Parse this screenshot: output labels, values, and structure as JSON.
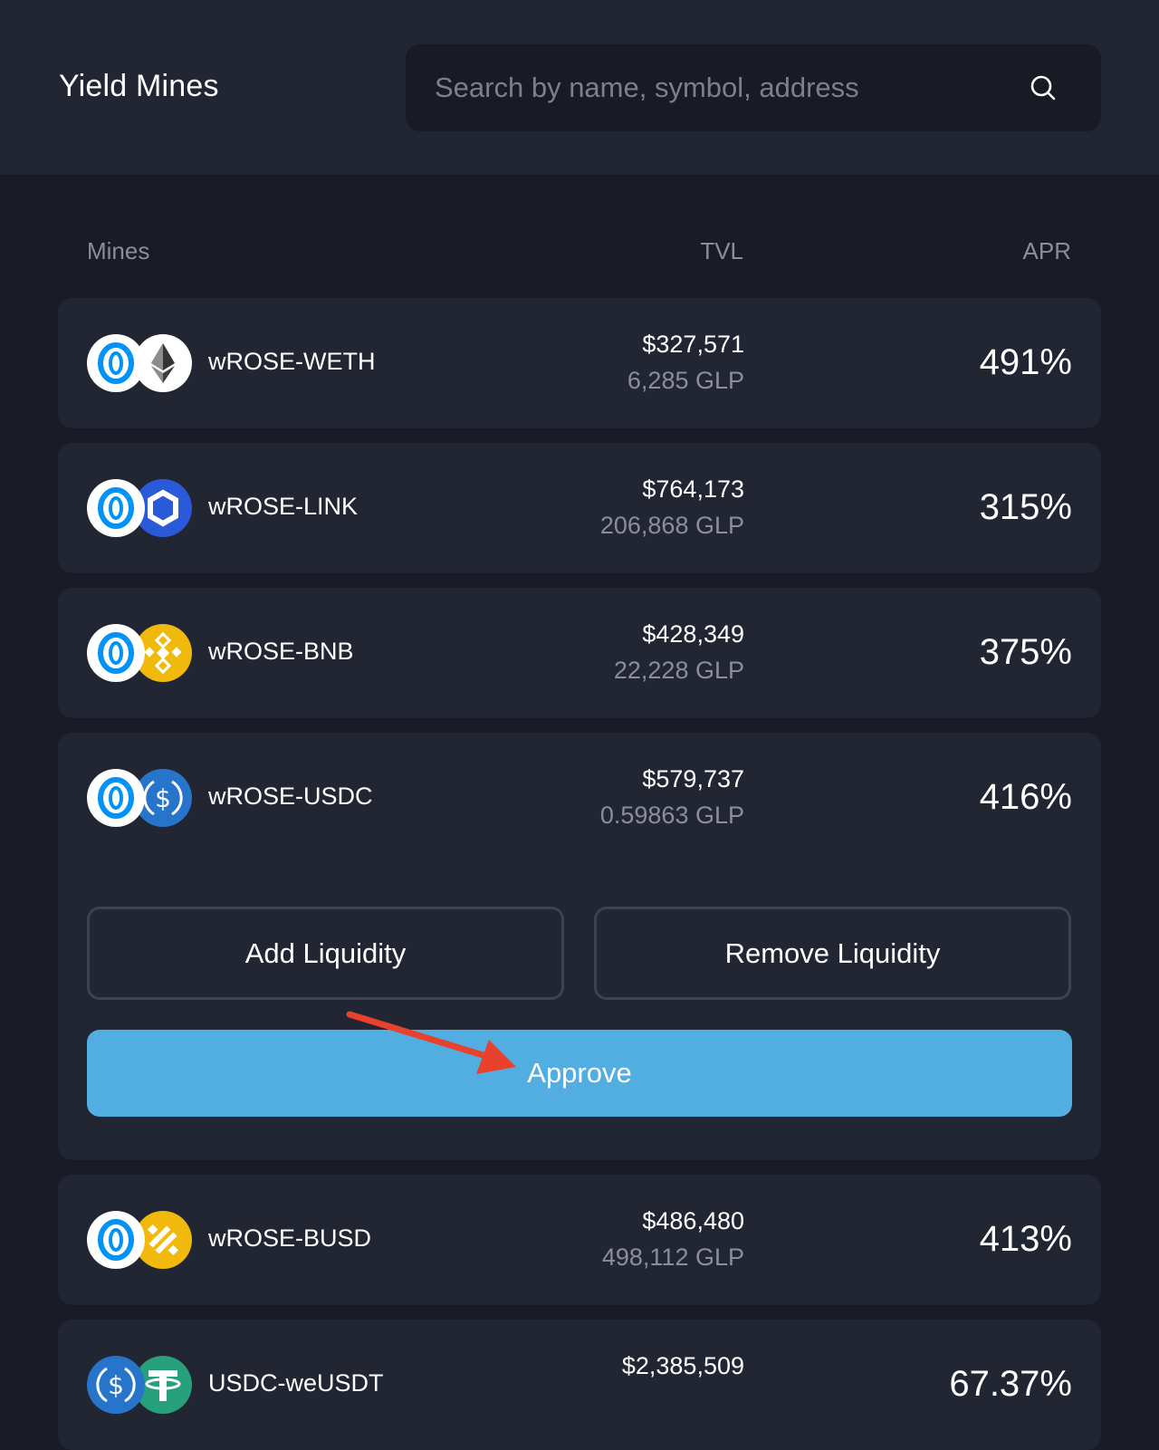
{
  "header": {
    "title": "Yield Mines",
    "search_placeholder": "Search by name, symbol, address"
  },
  "columns": {
    "mines": "Mines",
    "tvl": "TVL",
    "apr": "APR"
  },
  "mines": [
    {
      "pair": "wROSE-WETH",
      "tvl_usd": "$327,571",
      "tvl_glp": "6,285 GLP",
      "apr": "491%",
      "token_a": "rose-icon",
      "token_b": "eth-icon"
    },
    {
      "pair": "wROSE-LINK",
      "tvl_usd": "$764,173",
      "tvl_glp": "206,868 GLP",
      "apr": "315%",
      "token_a": "rose-icon",
      "token_b": "link-icon"
    },
    {
      "pair": "wROSE-BNB",
      "tvl_usd": "$428,349",
      "tvl_glp": "22,228 GLP",
      "apr": "375%",
      "token_a": "rose-icon",
      "token_b": "bnb-icon"
    },
    {
      "pair": "wROSE-USDC",
      "tvl_usd": "$579,737",
      "tvl_glp": "0.59863 GLP",
      "apr": "416%",
      "token_a": "rose-icon",
      "token_b": "usdc-icon"
    },
    {
      "pair": "wROSE-BUSD",
      "tvl_usd": "$486,480",
      "tvl_glp": "498,112 GLP",
      "apr": "413%",
      "token_a": "rose-icon",
      "token_b": "busd-icon"
    },
    {
      "pair": "USDC-weUSDT",
      "tvl_usd": "$2,385,509",
      "tvl_glp": "",
      "apr": "67.37%",
      "token_a": "usdc-icon",
      "token_b": "usdt-icon"
    }
  ],
  "expanded": {
    "add_liquidity": "Add Liquidity",
    "remove_liquidity": "Remove Liquidity",
    "approve": "Approve"
  },
  "colors": {
    "background": "#191b26",
    "card": "#222633",
    "accent": "#52aee0",
    "muted_text": "#8b8e99",
    "annotation_arrow": "#e8412c"
  }
}
